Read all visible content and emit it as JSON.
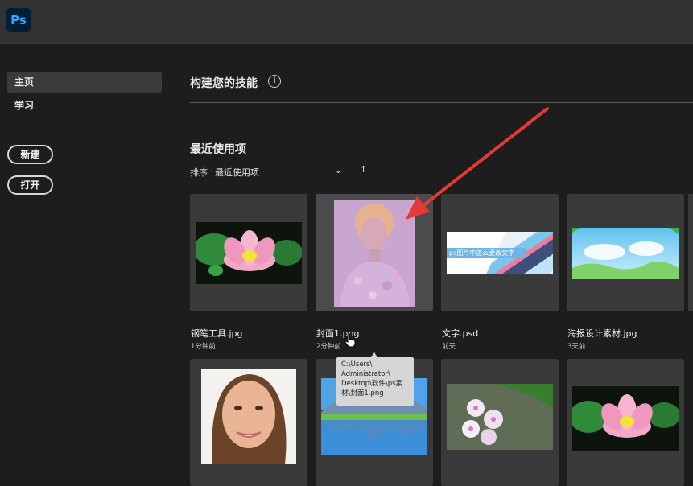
{
  "app": {
    "logo_text": "Ps"
  },
  "sidebar": {
    "items": [
      {
        "label": "主页"
      },
      {
        "label": "学习"
      }
    ],
    "new_label": "新建",
    "open_label": "打开"
  },
  "main": {
    "skills_title": "构建您的技能",
    "info_icon_text": "i",
    "recent_title": "最近使用项",
    "sort_label": "排序",
    "sort_value": "最近使用项",
    "sort_chevron": "⌄",
    "sort_direction": "↑"
  },
  "recent_files": [
    {
      "name": "钢笔工具.jpg",
      "time": "1分钟前",
      "thumb_icon": "lotus-image"
    },
    {
      "name": "封面1.png",
      "time": "2分钟前",
      "thumb_icon": "portrait-image"
    },
    {
      "name": "文字.psd",
      "time": "前天",
      "thumb_icon": "text-design-image",
      "thumb_text": "ps图片中怎么更改文字"
    },
    {
      "name": "海报设计素材.jpg",
      "time": "3天前",
      "thumb_icon": "landscape-image"
    }
  ],
  "recent_files_row2": [
    {
      "thumb_icon": "face-image"
    },
    {
      "thumb_icon": "lake-mountain-image"
    },
    {
      "thumb_icon": "plumeria-image"
    },
    {
      "thumb_icon": "lotus-image"
    }
  ],
  "tooltip": {
    "text": "C:\\Users\\\nAdministrator\\\nDesktop\\软件\\ps素\n材\\封面1.png"
  },
  "annotation": {
    "arrow_color": "#e53935"
  },
  "colors": {
    "background": "#1d1d1d",
    "topbar": "#323232",
    "card": "#3a3a3a",
    "ps_blue": "#31a8ff"
  }
}
